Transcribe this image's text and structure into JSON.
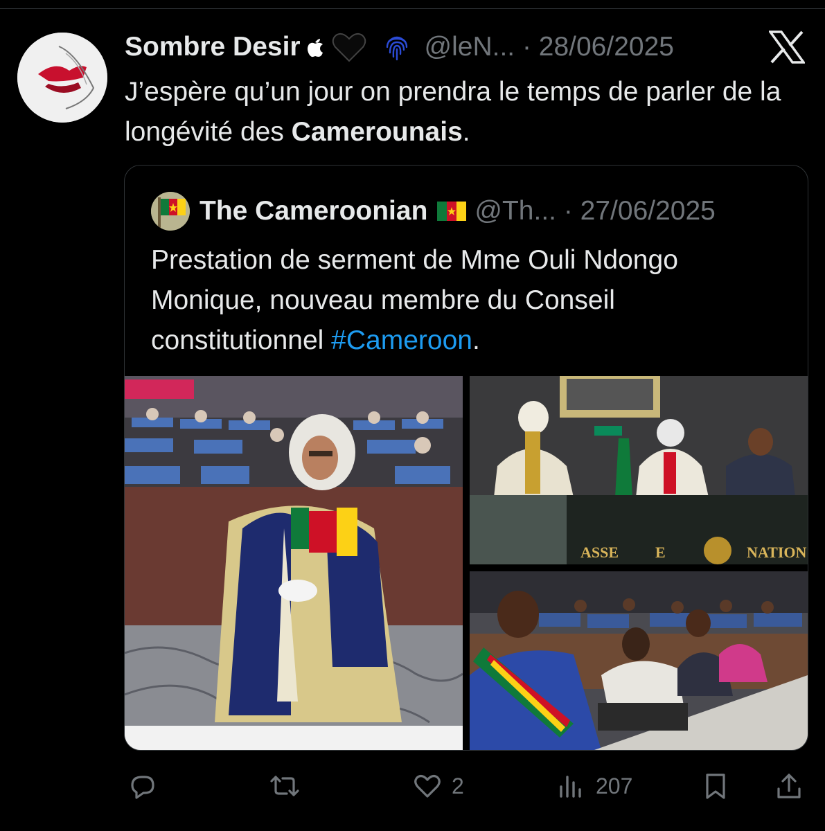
{
  "tweet": {
    "author_name": "Sombre Desir",
    "author_emoji": "🖤",
    "handle_date": "@leN... · 28/06/2025",
    "text_before": "J’espère qu’un jour on prendra le temps de parler de la longévité des ",
    "text_bold": "Camerounais",
    "text_after": "."
  },
  "quote": {
    "author_name": "The Cameroonian",
    "handle_date": "@Th... · 27/06/2025",
    "text_before": "Prestation de serment de Mme Ouli Ndongo Monique, nouveau membre du Conseil constitutionnel ",
    "hashtag": "#Cameroon",
    "text_after": ".",
    "media": [
      {
        "name": "photo-judge-in-robe"
      },
      {
        "name": "photo-assembly-podium",
        "banner_left": "ASSE",
        "banner_mid": "E",
        "banner_right": "NATION"
      },
      {
        "name": "photo-seated-deputies"
      }
    ]
  },
  "actions": {
    "reply_count": "",
    "retweet_count": "",
    "like_count": "2",
    "views_count": "207"
  },
  "colors": {
    "background": "#000000",
    "text": "#e7e9ea",
    "muted": "#71767b",
    "link": "#1d9bf0",
    "border": "#2f3336"
  },
  "icons": [
    "fingerprint-icon",
    "x-logo-icon",
    "reply-icon",
    "retweet-icon",
    "like-icon",
    "views-icon",
    "bookmark-icon",
    "share-icon"
  ]
}
